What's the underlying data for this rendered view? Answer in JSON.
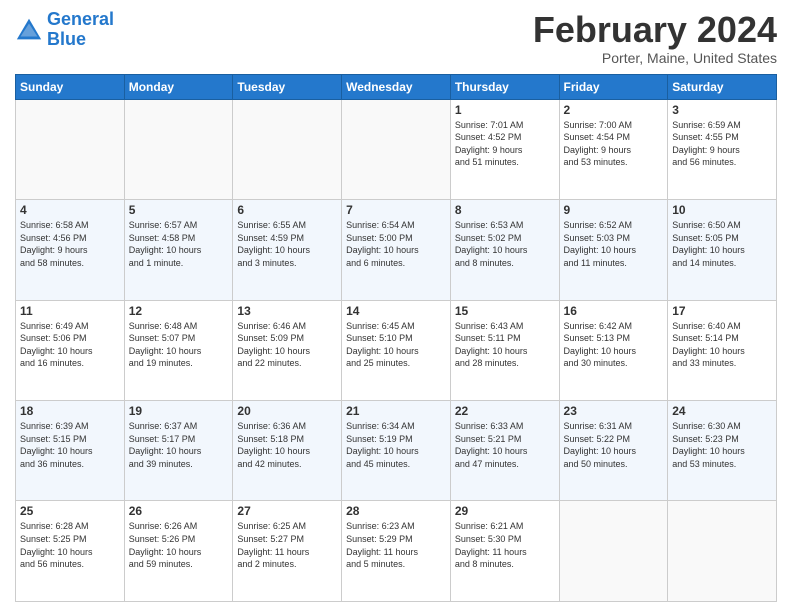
{
  "logo": {
    "line1": "General",
    "line2": "Blue"
  },
  "title": "February 2024",
  "location": "Porter, Maine, United States",
  "days_header": [
    "Sunday",
    "Monday",
    "Tuesday",
    "Wednesday",
    "Thursday",
    "Friday",
    "Saturday"
  ],
  "weeks": [
    [
      {
        "day": "",
        "info": ""
      },
      {
        "day": "",
        "info": ""
      },
      {
        "day": "",
        "info": ""
      },
      {
        "day": "",
        "info": ""
      },
      {
        "day": "1",
        "info": "Sunrise: 7:01 AM\nSunset: 4:52 PM\nDaylight: 9 hours\nand 51 minutes."
      },
      {
        "day": "2",
        "info": "Sunrise: 7:00 AM\nSunset: 4:54 PM\nDaylight: 9 hours\nand 53 minutes."
      },
      {
        "day": "3",
        "info": "Sunrise: 6:59 AM\nSunset: 4:55 PM\nDaylight: 9 hours\nand 56 minutes."
      }
    ],
    [
      {
        "day": "4",
        "info": "Sunrise: 6:58 AM\nSunset: 4:56 PM\nDaylight: 9 hours\nand 58 minutes."
      },
      {
        "day": "5",
        "info": "Sunrise: 6:57 AM\nSunset: 4:58 PM\nDaylight: 10 hours\nand 1 minute."
      },
      {
        "day": "6",
        "info": "Sunrise: 6:55 AM\nSunset: 4:59 PM\nDaylight: 10 hours\nand 3 minutes."
      },
      {
        "day": "7",
        "info": "Sunrise: 6:54 AM\nSunset: 5:00 PM\nDaylight: 10 hours\nand 6 minutes."
      },
      {
        "day": "8",
        "info": "Sunrise: 6:53 AM\nSunset: 5:02 PM\nDaylight: 10 hours\nand 8 minutes."
      },
      {
        "day": "9",
        "info": "Sunrise: 6:52 AM\nSunset: 5:03 PM\nDaylight: 10 hours\nand 11 minutes."
      },
      {
        "day": "10",
        "info": "Sunrise: 6:50 AM\nSunset: 5:05 PM\nDaylight: 10 hours\nand 14 minutes."
      }
    ],
    [
      {
        "day": "11",
        "info": "Sunrise: 6:49 AM\nSunset: 5:06 PM\nDaylight: 10 hours\nand 16 minutes."
      },
      {
        "day": "12",
        "info": "Sunrise: 6:48 AM\nSunset: 5:07 PM\nDaylight: 10 hours\nand 19 minutes."
      },
      {
        "day": "13",
        "info": "Sunrise: 6:46 AM\nSunset: 5:09 PM\nDaylight: 10 hours\nand 22 minutes."
      },
      {
        "day": "14",
        "info": "Sunrise: 6:45 AM\nSunset: 5:10 PM\nDaylight: 10 hours\nand 25 minutes."
      },
      {
        "day": "15",
        "info": "Sunrise: 6:43 AM\nSunset: 5:11 PM\nDaylight: 10 hours\nand 28 minutes."
      },
      {
        "day": "16",
        "info": "Sunrise: 6:42 AM\nSunset: 5:13 PM\nDaylight: 10 hours\nand 30 minutes."
      },
      {
        "day": "17",
        "info": "Sunrise: 6:40 AM\nSunset: 5:14 PM\nDaylight: 10 hours\nand 33 minutes."
      }
    ],
    [
      {
        "day": "18",
        "info": "Sunrise: 6:39 AM\nSunset: 5:15 PM\nDaylight: 10 hours\nand 36 minutes."
      },
      {
        "day": "19",
        "info": "Sunrise: 6:37 AM\nSunset: 5:17 PM\nDaylight: 10 hours\nand 39 minutes."
      },
      {
        "day": "20",
        "info": "Sunrise: 6:36 AM\nSunset: 5:18 PM\nDaylight: 10 hours\nand 42 minutes."
      },
      {
        "day": "21",
        "info": "Sunrise: 6:34 AM\nSunset: 5:19 PM\nDaylight: 10 hours\nand 45 minutes."
      },
      {
        "day": "22",
        "info": "Sunrise: 6:33 AM\nSunset: 5:21 PM\nDaylight: 10 hours\nand 47 minutes."
      },
      {
        "day": "23",
        "info": "Sunrise: 6:31 AM\nSunset: 5:22 PM\nDaylight: 10 hours\nand 50 minutes."
      },
      {
        "day": "24",
        "info": "Sunrise: 6:30 AM\nSunset: 5:23 PM\nDaylight: 10 hours\nand 53 minutes."
      }
    ],
    [
      {
        "day": "25",
        "info": "Sunrise: 6:28 AM\nSunset: 5:25 PM\nDaylight: 10 hours\nand 56 minutes."
      },
      {
        "day": "26",
        "info": "Sunrise: 6:26 AM\nSunset: 5:26 PM\nDaylight: 10 hours\nand 59 minutes."
      },
      {
        "day": "27",
        "info": "Sunrise: 6:25 AM\nSunset: 5:27 PM\nDaylight: 11 hours\nand 2 minutes."
      },
      {
        "day": "28",
        "info": "Sunrise: 6:23 AM\nSunset: 5:29 PM\nDaylight: 11 hours\nand 5 minutes."
      },
      {
        "day": "29",
        "info": "Sunrise: 6:21 AM\nSunset: 5:30 PM\nDaylight: 11 hours\nand 8 minutes."
      },
      {
        "day": "",
        "info": ""
      },
      {
        "day": "",
        "info": ""
      }
    ]
  ]
}
